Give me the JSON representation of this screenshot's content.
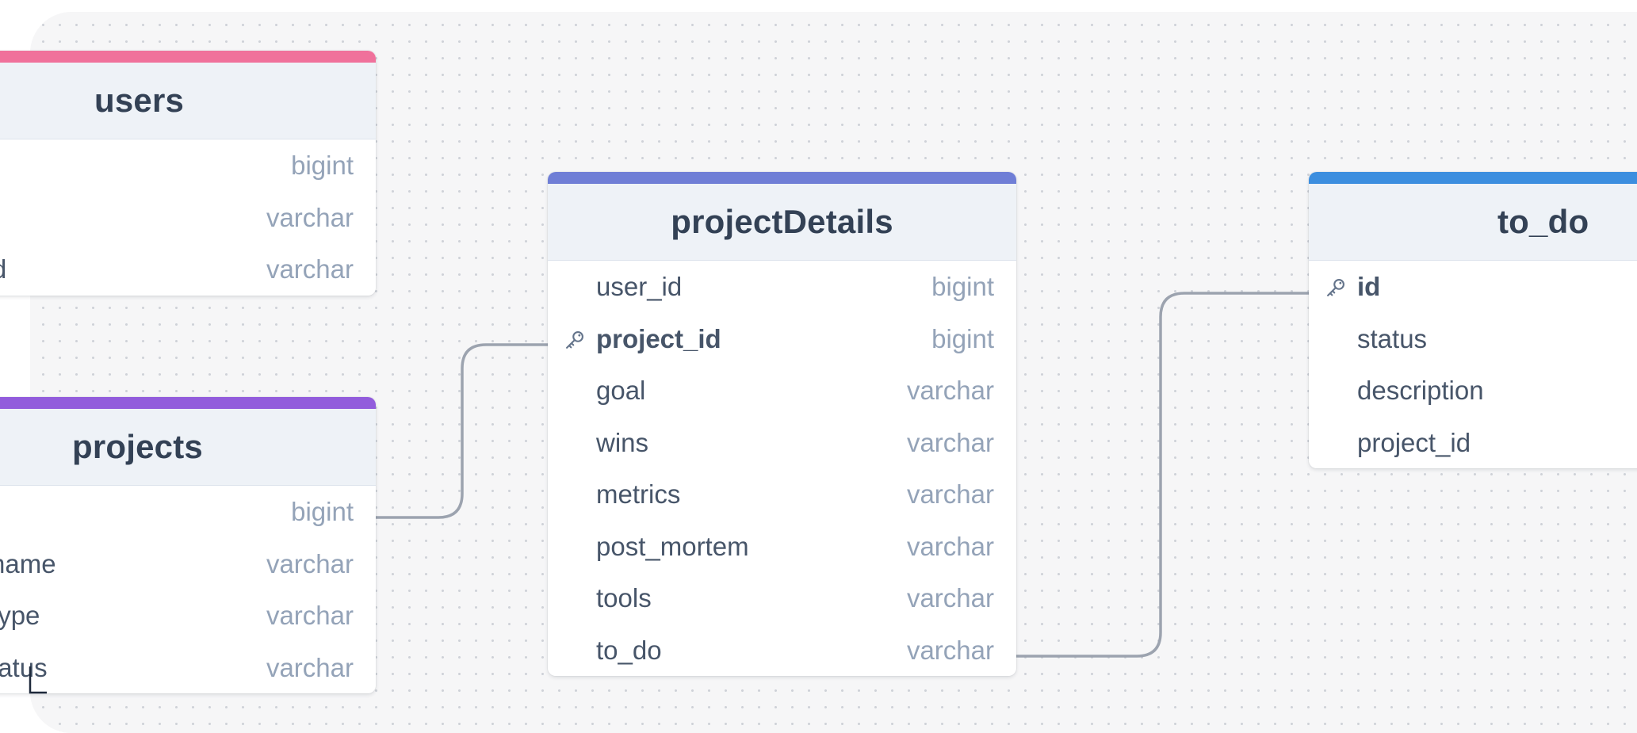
{
  "diagram": {
    "colors": {
      "users": "#f0719b",
      "projects": "#925cdc",
      "projectDetails": "#6f7ed6",
      "to_do": "#3c8edf",
      "edge": "#9ca3af"
    },
    "tables": [
      {
        "name": "users",
        "fields": [
          {
            "name": "",
            "type": "bigint"
          },
          {
            "name": "",
            "type": "varchar"
          },
          {
            "name": "vord",
            "type": "varchar"
          }
        ]
      },
      {
        "name": "projects",
        "fields": [
          {
            "name": "",
            "type": "bigint"
          },
          {
            "name": "ct_name",
            "type": "varchar"
          },
          {
            "name": "ct_type",
            "type": "varchar"
          },
          {
            "name": "t_status",
            "type": "varchar"
          }
        ]
      },
      {
        "name": "projectDetails",
        "fields": [
          {
            "name": "user_id",
            "type": "bigint"
          },
          {
            "name": "project_id",
            "type": "bigint",
            "primary_key": true,
            "icon": "key-icon"
          },
          {
            "name": "goal",
            "type": "varchar"
          },
          {
            "name": "wins",
            "type": "varchar"
          },
          {
            "name": "metrics",
            "type": "varchar"
          },
          {
            "name": "post_mortem",
            "type": "varchar"
          },
          {
            "name": "tools",
            "type": "varchar"
          },
          {
            "name": "to_do",
            "type": "varchar"
          }
        ]
      },
      {
        "name": "to_do",
        "fields": [
          {
            "name": "id",
            "type": "",
            "primary_key": true,
            "icon": "key-icon"
          },
          {
            "name": "status",
            "type": ""
          },
          {
            "name": "description",
            "type": ""
          },
          {
            "name": "project_id",
            "type": ""
          }
        ]
      }
    ],
    "relationships": [
      {
        "from": "projects.id",
        "to": "projectDetails.project_id"
      },
      {
        "from": "projectDetails.to_do",
        "to": "to_do.id"
      }
    ]
  }
}
